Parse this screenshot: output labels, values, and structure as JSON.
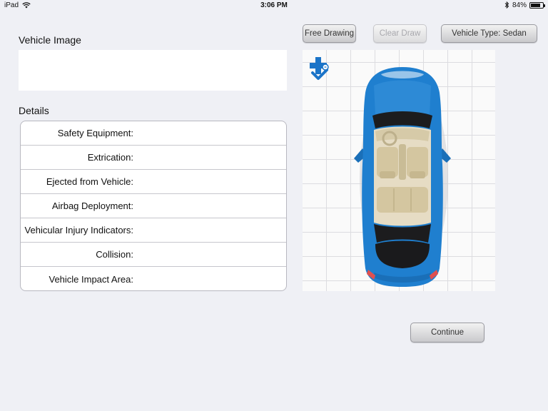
{
  "status_bar": {
    "device": "iPad",
    "time": "3:06 PM",
    "battery": "84%",
    "battery_level": 0.84
  },
  "vehicle_image": {
    "title": "Vehicle Image"
  },
  "details": {
    "title": "Details",
    "rows": [
      {
        "label": "Safety Equipment:",
        "value": ""
      },
      {
        "label": "Extrication:",
        "value": ""
      },
      {
        "label": "Ejected from Vehicle:",
        "value": ""
      },
      {
        "label": "Airbag Deployment:",
        "value": ""
      },
      {
        "label": "Vehicular Injury Indicators:",
        "value": ""
      },
      {
        "label": "Collision:",
        "value": ""
      },
      {
        "label": "Vehicle Impact Area:",
        "value": ""
      }
    ]
  },
  "toolbar": {
    "free_drawing": "Free Drawing",
    "clear_draw": "Clear Draw",
    "vehicle_type": "Vehicle Type: Sedan"
  },
  "canvas": {
    "add_icon": "add-marker-icon",
    "vehicle": "sedan-top-view",
    "car_color": "#1f7fcf"
  },
  "footer": {
    "continue": "Continue"
  }
}
